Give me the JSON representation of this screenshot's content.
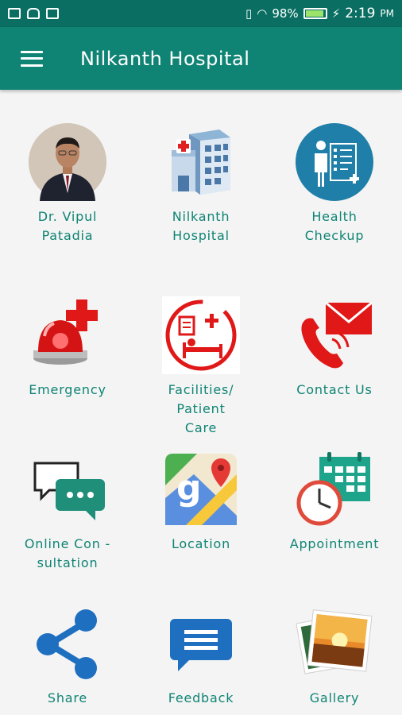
{
  "status_bar": {
    "battery_percent": "98%",
    "time": "2:19",
    "ampm": "PM"
  },
  "app_bar": {
    "title": "Nilkanth Hospital"
  },
  "tiles": [
    {
      "label": "Dr. Vipul\nPatadia",
      "icon": "doctor-avatar"
    },
    {
      "label": "Nilkanth\nHospital",
      "icon": "hospital-building-icon"
    },
    {
      "label": "Health\nCheckup",
      "icon": "health-checkup-icon"
    },
    {
      "label": "Emergency",
      "icon": "emergency-siren-icon"
    },
    {
      "label": "Facilities/\nPatient\nCare",
      "icon": "patient-bed-icon"
    },
    {
      "label": "Contact Us",
      "icon": "phone-mail-icon"
    },
    {
      "label": "Online Con -\nsultation",
      "icon": "chat-bubbles-icon"
    },
    {
      "label": "Location",
      "icon": "map-pin-icon"
    },
    {
      "label": "Appointment",
      "icon": "calendar-clock-icon"
    },
    {
      "label": "Share",
      "icon": "share-icon"
    },
    {
      "label": "Feedback",
      "icon": "feedback-bubble-icon"
    },
    {
      "label": "Gallery",
      "icon": "photo-gallery-icon"
    }
  ],
  "colors": {
    "status_bar": "#0a6f62",
    "app_bar": "#0f8474",
    "label_text": "#0f8474",
    "background": "#f4f4f4"
  }
}
